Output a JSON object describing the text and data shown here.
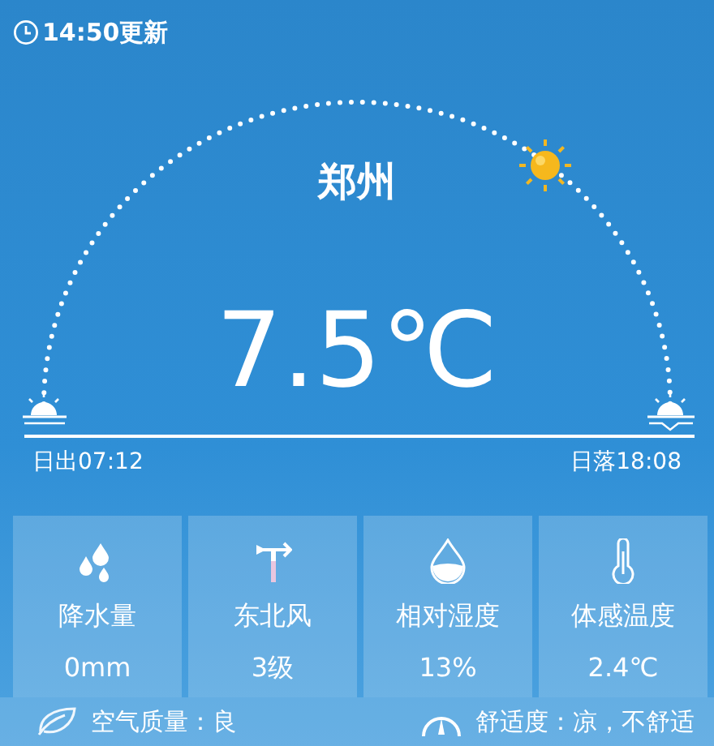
{
  "updated": "14:50更新",
  "city": "郑州",
  "temperature": "7.5℃",
  "sunrise": "日出07:12",
  "sunset": "日落18:08",
  "cards": [
    {
      "kind": "rain",
      "label": "降水量",
      "value": "0mm"
    },
    {
      "kind": "wind",
      "label": "东北风",
      "value": "3级"
    },
    {
      "kind": "humidity",
      "label": "相对湿度",
      "value": "13%"
    },
    {
      "kind": "feels",
      "label": "体感温度",
      "value": "2.4℃"
    }
  ],
  "footer": {
    "air_quality": "空气质量：良",
    "comfort": "舒适度：凉，不舒适"
  }
}
